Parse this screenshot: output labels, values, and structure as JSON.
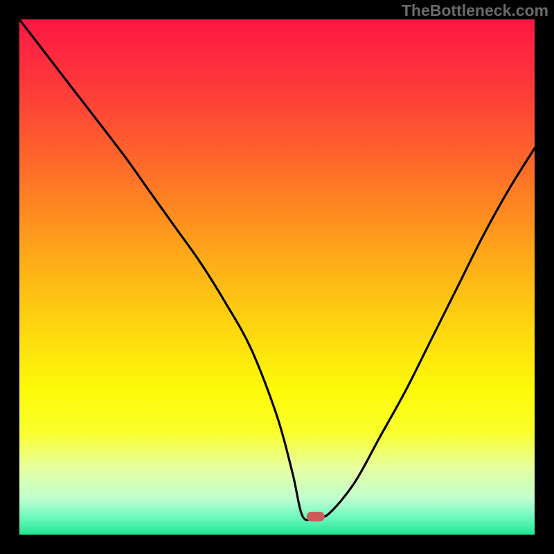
{
  "watermark": "TheBottleneck.com",
  "chart_data": {
    "type": "line",
    "title": "",
    "xlabel": "",
    "ylabel": "",
    "xlim": [
      0,
      100
    ],
    "ylim": [
      0,
      100
    ],
    "x": [
      0,
      10,
      20,
      25,
      30,
      35,
      40,
      45,
      50,
      53,
      55,
      57.5,
      60,
      65,
      70,
      75,
      80,
      85,
      90,
      95,
      100
    ],
    "y": [
      100,
      87,
      74,
      67,
      60,
      53,
      45,
      36,
      23,
      12,
      3.5,
      3.5,
      4,
      10,
      19,
      28,
      38,
      48,
      58,
      67,
      75
    ],
    "marker": {
      "x": 57.5,
      "y": 3.5,
      "color": "#d05a5a"
    },
    "gradient_stops": [
      {
        "offset": 0.0,
        "color": "#fd1744"
      },
      {
        "offset": 0.15,
        "color": "#fe3f38"
      },
      {
        "offset": 0.3,
        "color": "#fe7027"
      },
      {
        "offset": 0.45,
        "color": "#fea61a"
      },
      {
        "offset": 0.6,
        "color": "#fdd70f"
      },
      {
        "offset": 0.72,
        "color": "#fdfa0a"
      },
      {
        "offset": 0.8,
        "color": "#faff2a"
      },
      {
        "offset": 0.87,
        "color": "#e6ffa0"
      },
      {
        "offset": 0.93,
        "color": "#c0ffd0"
      },
      {
        "offset": 0.965,
        "color": "#70f9c0"
      },
      {
        "offset": 1.0,
        "color": "#20e790"
      }
    ],
    "frame_color": "#000000",
    "line_color": "#000000"
  }
}
